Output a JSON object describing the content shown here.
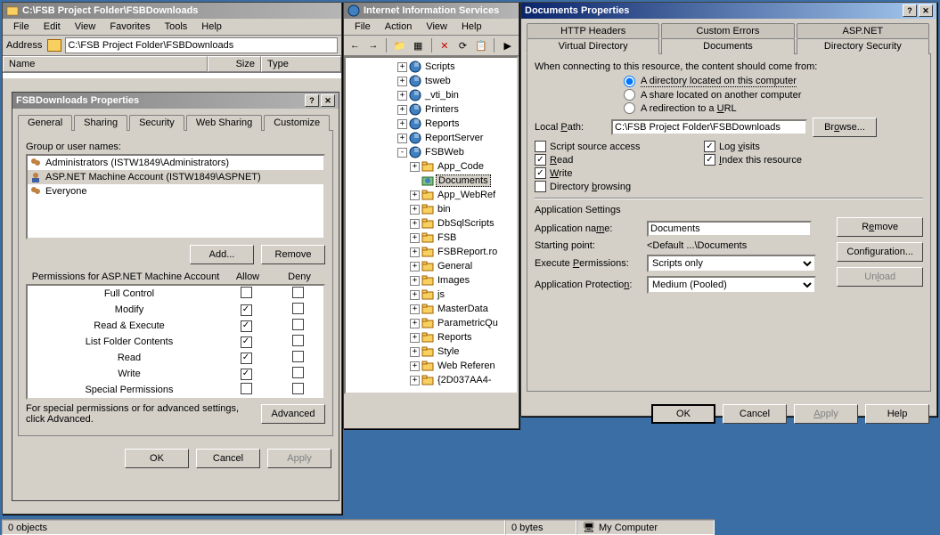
{
  "explorer": {
    "title": "C:\\FSB Project Folder\\FSBDownloads",
    "menu": [
      "File",
      "Edit",
      "View",
      "Favorites",
      "Tools",
      "Help"
    ],
    "address_label": "Address",
    "address_value": "C:\\FSB Project Folder\\FSBDownloads",
    "cols": {
      "name": "Name",
      "size": "Size",
      "type": "Type"
    },
    "status": {
      "objects": "0 objects",
      "bytes": "0 bytes",
      "loc": "My Computer"
    }
  },
  "secprop": {
    "title": "FSBDownloads Properties",
    "tabs": [
      "General",
      "Sharing",
      "Security",
      "Web Sharing",
      "Customize"
    ],
    "active_tab": 2,
    "group_lbl": "Group or user names:",
    "users": [
      "Administrators (ISTW1849\\Administrators)",
      "ASP.NET Machine Account (ISTW1849\\ASPNET)",
      "Everyone"
    ],
    "selected_user": 1,
    "add_btn": "Add...",
    "remove_btn": "Remove",
    "perm_for": "Permissions for ASP.NET Machine Account",
    "allow": "Allow",
    "deny": "Deny",
    "perms": [
      {
        "n": "Full Control",
        "a": false,
        "d": false
      },
      {
        "n": "Modify",
        "a": true,
        "d": false
      },
      {
        "n": "Read & Execute",
        "a": true,
        "d": false
      },
      {
        "n": "List Folder Contents",
        "a": true,
        "d": false
      },
      {
        "n": "Read",
        "a": true,
        "d": false
      },
      {
        "n": "Write",
        "a": true,
        "d": false
      },
      {
        "n": "Special Permissions",
        "a": false,
        "d": false
      }
    ],
    "note": "For special permissions or for advanced settings, click Advanced.",
    "advanced_btn": "Advanced",
    "ok": "OK",
    "cancel": "Cancel",
    "apply": "Apply"
  },
  "iis": {
    "title": "Internet Information Services",
    "menu": [
      "File",
      "Action",
      "View",
      "Help"
    ],
    "tree": [
      {
        "ind": 4,
        "tw": "+",
        "icon": "globe",
        "label": "Scripts"
      },
      {
        "ind": 4,
        "tw": "+",
        "icon": "globe",
        "label": "tsweb"
      },
      {
        "ind": 4,
        "tw": "+",
        "icon": "globe",
        "label": "_vti_bin"
      },
      {
        "ind": 4,
        "tw": "+",
        "icon": "globe",
        "label": "Printers"
      },
      {
        "ind": 4,
        "tw": "+",
        "icon": "globe",
        "label": "Reports"
      },
      {
        "ind": 4,
        "tw": "+",
        "icon": "globe",
        "label": "ReportServer"
      },
      {
        "ind": 4,
        "tw": "-",
        "icon": "globe",
        "label": "FSBWeb"
      },
      {
        "ind": 5,
        "tw": "+",
        "icon": "folder",
        "label": "App_Code"
      },
      {
        "ind": 5,
        "tw": "",
        "icon": "web",
        "label": "Documents",
        "sel": true
      },
      {
        "ind": 5,
        "tw": "+",
        "icon": "folder",
        "label": "App_WebRef"
      },
      {
        "ind": 5,
        "tw": "+",
        "icon": "folder",
        "label": "bin"
      },
      {
        "ind": 5,
        "tw": "+",
        "icon": "folder",
        "label": "DbSqlScripts"
      },
      {
        "ind": 5,
        "tw": "+",
        "icon": "folder",
        "label": "FSB"
      },
      {
        "ind": 5,
        "tw": "+",
        "icon": "folder",
        "label": "FSBReport.ro"
      },
      {
        "ind": 5,
        "tw": "+",
        "icon": "folder",
        "label": "General"
      },
      {
        "ind": 5,
        "tw": "+",
        "icon": "folder",
        "label": "Images"
      },
      {
        "ind": 5,
        "tw": "+",
        "icon": "folder",
        "label": "js"
      },
      {
        "ind": 5,
        "tw": "+",
        "icon": "folder",
        "label": "MasterData"
      },
      {
        "ind": 5,
        "tw": "+",
        "icon": "folder",
        "label": "ParametricQu"
      },
      {
        "ind": 5,
        "tw": "+",
        "icon": "folder",
        "label": "Reports"
      },
      {
        "ind": 5,
        "tw": "+",
        "icon": "folder",
        "label": "Style"
      },
      {
        "ind": 5,
        "tw": "+",
        "icon": "folder",
        "label": "Web Referen"
      },
      {
        "ind": 5,
        "tw": "+",
        "icon": "folder",
        "label": "{2D037AA4-"
      }
    ]
  },
  "docprop": {
    "title": "Documents Properties",
    "tabs_row1": [
      "HTTP Headers",
      "Custom Errors",
      "ASP.NET"
    ],
    "tabs_row2": [
      "Virtual Directory",
      "Documents",
      "Directory Security"
    ],
    "active_tab": "Virtual Directory",
    "connect_lbl": "When connecting to this resource, the content should come from:",
    "radios": [
      {
        "t": "A directory located on this computer",
        "c": true
      },
      {
        "t": "A share located on another computer",
        "c": false
      },
      {
        "t": "A redirection to a URL",
        "c": false
      }
    ],
    "local_path_lbl": "Local Path:",
    "local_path": "C:\\FSB Project Folder\\FSBDownloads",
    "browse_btn": "Browse...",
    "checks": [
      {
        "t": "Script source access",
        "c": false
      },
      {
        "t": "Log visits",
        "c": true
      },
      {
        "t": "Read",
        "c": true
      },
      {
        "t": "Index this resource",
        "c": true
      },
      {
        "t": "Write",
        "c": true
      },
      {
        "t": "",
        "c": null
      },
      {
        "t": "Directory browsing",
        "c": false
      }
    ],
    "app_settings": "Application Settings",
    "app_name_lbl": "Application name:",
    "app_name": "Documents",
    "remove_btn": "Remove",
    "start_lbl": "Starting point:",
    "start_val": "<Default ...\\Documents",
    "config_btn": "Configuration...",
    "exec_lbl": "Execute Permissions:",
    "exec_val": "Scripts only",
    "prot_lbl": "Application Protection:",
    "prot_val": "Medium (Pooled)",
    "unload_btn": "Unload",
    "ok": "OK",
    "cancel": "Cancel",
    "apply": "Apply",
    "help": "Help"
  }
}
